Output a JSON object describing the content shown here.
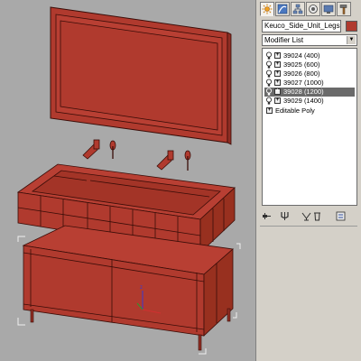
{
  "panel": {
    "tabs": [
      {
        "icon": "sun-icon",
        "active": true
      },
      {
        "icon": "modify-curve-icon",
        "active": false
      },
      {
        "icon": "hierarchy-icon",
        "active": false
      },
      {
        "icon": "motion-icon",
        "active": false
      },
      {
        "icon": "display-icon",
        "active": false
      },
      {
        "icon": "hammer-icon",
        "active": false
      }
    ],
    "object_name": "Keuco_Side_Unit_Legs",
    "object_color": "#b03a2e",
    "modifier_list_label": "Modifier List",
    "stack": [
      {
        "label": "39024 (400)",
        "selected": false
      },
      {
        "label": "39025 (600)",
        "selected": false
      },
      {
        "label": "39026 (800)",
        "selected": false
      },
      {
        "label": "39027 (1000)",
        "selected": false
      },
      {
        "label": "39028 (1200)",
        "selected": true
      },
      {
        "label": "39029 (1400)",
        "selected": false
      }
    ],
    "base_object": "Editable Poly",
    "toolbar_icons": [
      "pin-stack-icon",
      "show-end-result-icon",
      "make-unique-icon",
      "remove-modifier-icon",
      "configure-sets-icon"
    ]
  },
  "viewport": {
    "model_color": "#b03a2e",
    "edge_color": "#3a0d08",
    "background": "#a9a9a9"
  }
}
